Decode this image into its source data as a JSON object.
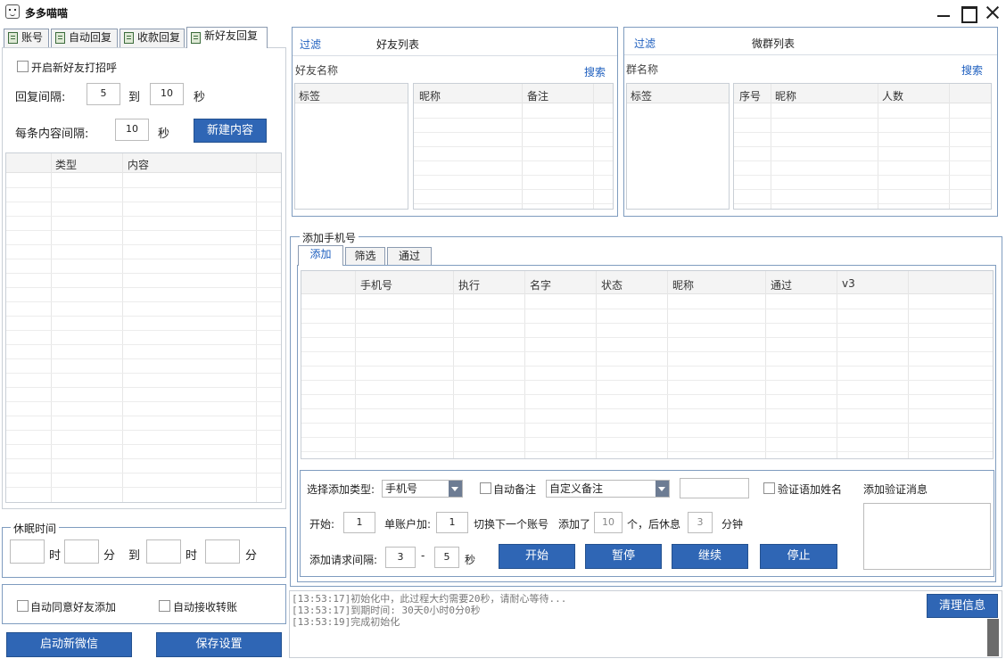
{
  "window": {
    "title": "多多喵喵"
  },
  "left_tabs": [
    {
      "label": "账号"
    },
    {
      "label": "自动回复"
    },
    {
      "label": "收款回复"
    },
    {
      "label": "新好友回复"
    }
  ],
  "new_friend": {
    "greet_label": "开启新好友打招呼",
    "reply_interval_label": "回复间隔:",
    "reply_min": "5",
    "to_label": "到",
    "reply_max": "10",
    "sec_label": "秒",
    "item_interval_label": "每条内容间隔:",
    "item_interval": "10",
    "item_sec_label": "秒",
    "new_content_button": "新建内容",
    "columns": [
      "类型",
      "内容"
    ]
  },
  "sleep": {
    "title": "休眠时间",
    "hour_label": "时",
    "min_label": "分",
    "to_label": "到",
    "hour2_label": "时",
    "min2_label": "分"
  },
  "options": {
    "auto_accept_label": "自动同意好友添加",
    "auto_receive_label": "自动接收转账"
  },
  "bottom_buttons": {
    "start_wechat": "启动新微信",
    "save_settings": "保存设置"
  },
  "friend_list": {
    "filter": "过滤",
    "title": "好友列表",
    "name_label": "好友名称",
    "search": "搜索",
    "tag_col": "标签",
    "columns": [
      "昵称",
      "备注"
    ]
  },
  "group_list": {
    "filter": "过滤",
    "title": "微群列表",
    "name_label": "群名称",
    "search": "搜索",
    "tag_col": "标签",
    "columns": [
      "序号",
      "昵称",
      "人数"
    ]
  },
  "add_phone": {
    "title": "添加手机号",
    "tabs": [
      "添加",
      "筛选",
      "通过"
    ],
    "columns": [
      "手机号",
      "执行",
      "名字",
      "状态",
      "昵称",
      "通过",
      "v3"
    ],
    "type_label": "选择添加类型:",
    "type_value": "手机号",
    "auto_remark_label": "自动备注",
    "remark_value": "自定义备注",
    "verify_name_label": "验证语加姓名",
    "add_verify_msg_label": "添加验证消息",
    "start_label": "开始:",
    "start_value": "1",
    "per_account_label": "单账户加:",
    "per_account_value": "1",
    "switch_label": "切换下一个账号",
    "added_label": "添加了",
    "added_value": "10",
    "rest_label": "个，后休息",
    "rest_value": "3",
    "minute_label": "分钟",
    "req_interval_label": "添加请求间隔:",
    "req_min": "3",
    "dash": "-",
    "req_max": "5",
    "req_sec": "秒",
    "buttons": {
      "start": "开始",
      "pause": "暂停",
      "resume": "继续",
      "stop": "停止"
    }
  },
  "log": {
    "lines": [
      "[13:53:17]初始化中，此过程大约需要20秒，请耐心等待...",
      "[13:53:17]到期时间: 30天0小时0分0秒",
      "[13:53:19]完成初始化"
    ],
    "clear_button": "清理信息"
  }
}
